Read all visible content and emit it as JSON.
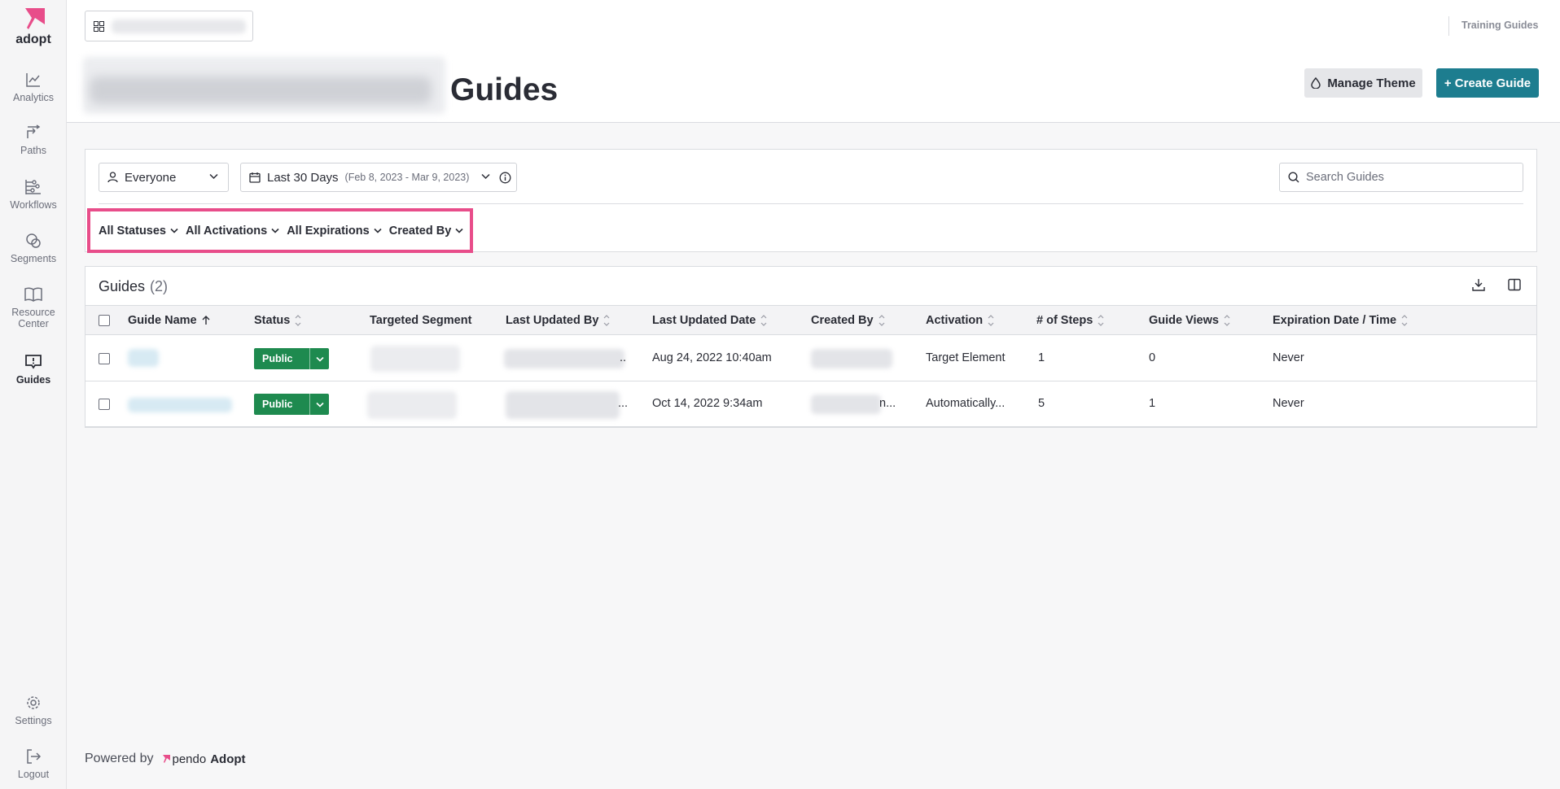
{
  "sidebar": {
    "logo_text": "adopt",
    "items": [
      {
        "label": "Analytics"
      },
      {
        "label": "Paths"
      },
      {
        "label": "Workflows"
      },
      {
        "label": "Segments"
      },
      {
        "label": "Resource Center"
      },
      {
        "label": "Guides"
      }
    ],
    "bottom": [
      {
        "label": "Settings"
      },
      {
        "label": "Logout"
      }
    ]
  },
  "header": {
    "training_link": "Training Guides",
    "title": "Guides",
    "manage_theme": "Manage Theme",
    "create_guide": "+ Create Guide"
  },
  "filters": {
    "segment": "Everyone",
    "date_label": "Last 30 Days",
    "date_range": "(Feb 8, 2023 - Mar 9, 2023)",
    "search_placeholder": "Search Guides",
    "dropdowns": [
      "All Statuses",
      "All Activations",
      "All Expirations",
      "Created By"
    ]
  },
  "table": {
    "title": "Guides",
    "count": "(2)",
    "columns": [
      "Guide Name",
      "Status",
      "Targeted Segment",
      "Last Updated By",
      "Last Updated Date",
      "Created By",
      "Activation",
      "# of Steps",
      "Guide Views",
      "Expiration Date / Time"
    ],
    "rows": [
      {
        "status": "Public",
        "last_updated_suffix": "..",
        "last_updated_date": "Aug 24, 2022 10:40am",
        "created_by_suffix": "",
        "activation": "Target Element",
        "steps": "1",
        "views": "0",
        "expiration": "Never"
      },
      {
        "status": "Public",
        "last_updated_suffix": "...",
        "last_updated_date": "Oct 14, 2022 9:34am",
        "created_by_suffix": "n...",
        "activation": "Automatically...",
        "steps": "5",
        "views": "1",
        "expiration": "Never"
      }
    ]
  },
  "footer": {
    "powered_by": "Powered by",
    "brand_pendo": "pendo",
    "brand_adopt": "Adopt"
  },
  "colors": {
    "accent_pink": "#e84d8a",
    "create_button": "#1d7d8f",
    "status_public": "#1e8a4f"
  }
}
